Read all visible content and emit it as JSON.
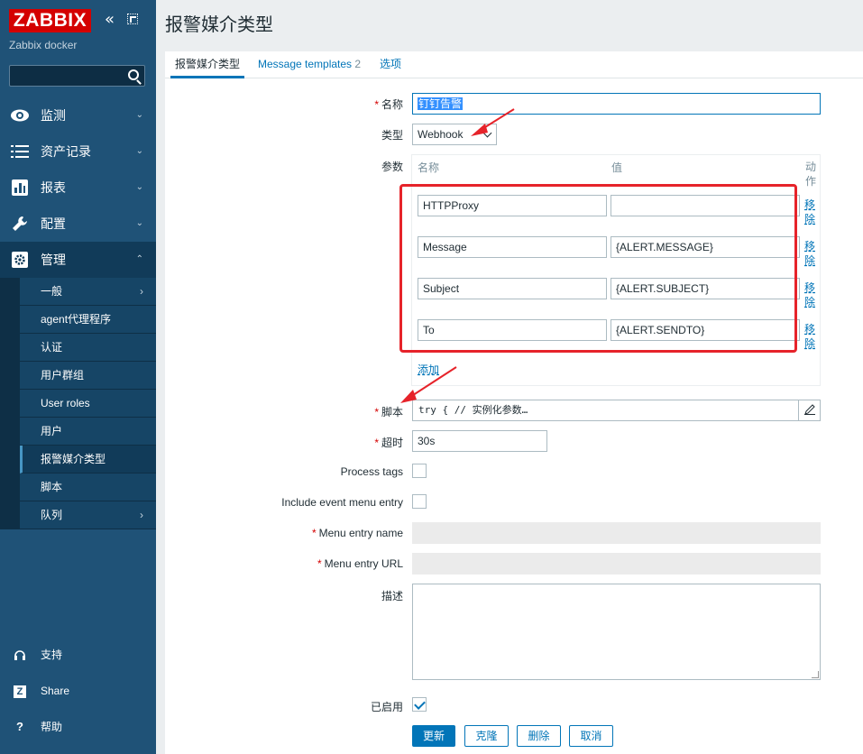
{
  "sidebar": {
    "logo": "ZABBIX",
    "server_name": "Zabbix docker",
    "search_placeholder": "",
    "menu": [
      {
        "label": "监测",
        "icon": "eye-icon"
      },
      {
        "label": "资产记录",
        "icon": "list-icon"
      },
      {
        "label": "报表",
        "icon": "chart-icon"
      },
      {
        "label": "配置",
        "icon": "wrench-icon"
      },
      {
        "label": "管理",
        "icon": "gear-icon"
      }
    ],
    "submenu": [
      {
        "label": "一般"
      },
      {
        "label": "agent代理程序"
      },
      {
        "label": "认证"
      },
      {
        "label": "用户群组"
      },
      {
        "label": "User roles"
      },
      {
        "label": "用户"
      },
      {
        "label": "报警媒介类型"
      },
      {
        "label": "脚本"
      },
      {
        "label": "队列"
      }
    ],
    "bottom": [
      {
        "label": "支持",
        "icon": "headset-icon"
      },
      {
        "label": "Share",
        "icon": "z-share-icon"
      },
      {
        "label": "帮助",
        "icon": "help-icon"
      }
    ]
  },
  "page": {
    "title": "报警媒介类型"
  },
  "tabs": [
    {
      "label": "报警媒介类型"
    },
    {
      "label": "Message templates"
    },
    {
      "label": "选项"
    }
  ],
  "tabs_count": "2",
  "form": {
    "name_label": "名称",
    "name_value": "钉钉告警",
    "type_label": "类型",
    "type_value": "Webhook",
    "params_label": "参数",
    "params_header_name": "名称",
    "params_header_value": "值",
    "params_header_action": "动作",
    "params": [
      {
        "name": "HTTPProxy",
        "value": ""
      },
      {
        "name": "Message",
        "value": "{ALERT.MESSAGE}"
      },
      {
        "name": "Subject",
        "value": "{ALERT.SUBJECT}"
      },
      {
        "name": "To",
        "value": "{ALERT.SENDTO}"
      }
    ],
    "remove_label": "移除",
    "add_label": "添加",
    "script_label": "脚本",
    "script_value": "try { // 实例化参数…",
    "timeout_label": "超时",
    "timeout_value": "30s",
    "process_tags_label": "Process tags",
    "include_event_menu_label": "Include event menu entry",
    "menu_entry_name_label": "Menu entry name",
    "menu_entry_url_label": "Menu entry URL",
    "description_label": "描述",
    "enabled_label": "已启用"
  },
  "buttons": {
    "update": "更新",
    "clone": "克隆",
    "delete": "删除",
    "cancel": "取消"
  }
}
